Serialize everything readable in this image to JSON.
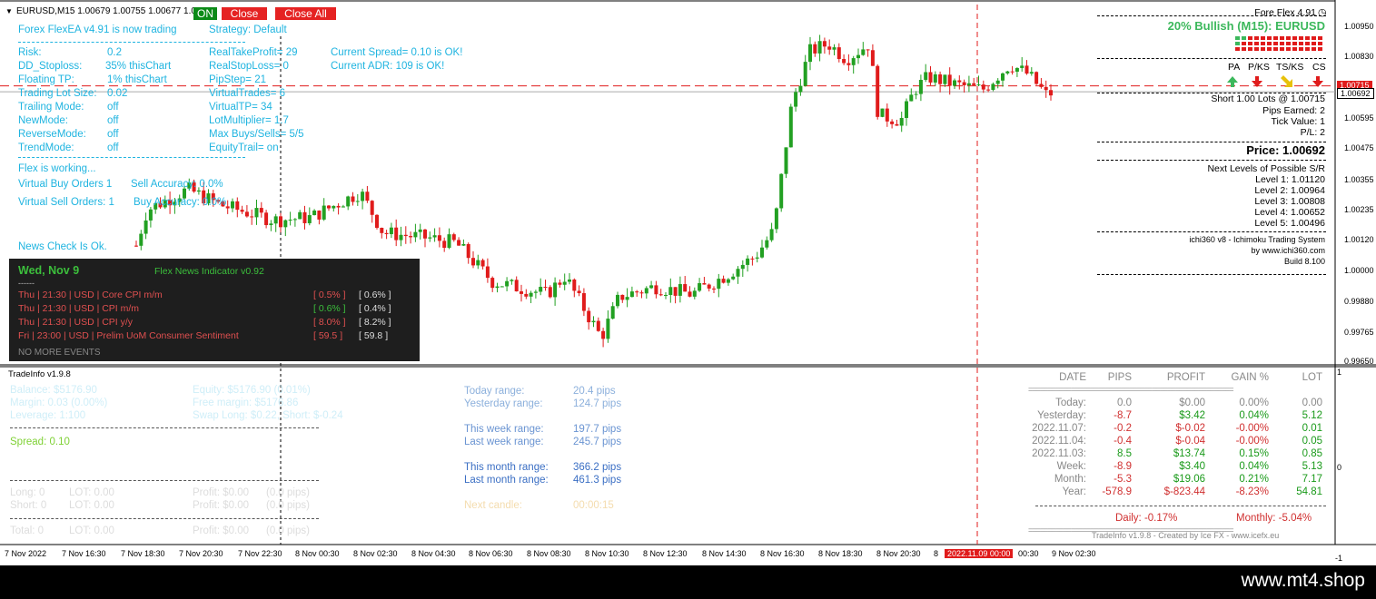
{
  "symbol_header": "EURUSD,M15  1.00679 1.00755 1.00677 1.00",
  "buttons": {
    "on": "ON",
    "close": "Close",
    "close_all": "Close All"
  },
  "flex_panel": {
    "title": "Forex FlexEA v4.91 is now trading",
    "strategy": "Strategy: Default",
    "risk_label": "Risk:",
    "risk_value": "0.2",
    "ddstop_label": "DD_Stoploss:",
    "ddstop_value": "35%  thisChart",
    "float_label": "Floating TP:",
    "float_value": "1%  thisChart",
    "lot_label": "Trading Lot Size:",
    "lot_value": "0.02",
    "trailing_label": "Trailing Mode:",
    "trailing_value": "off",
    "newmode_label": "NewMode:",
    "newmode_value": "off",
    "reverse_label": "ReverseMode:",
    "reverse_value": "off",
    "trend_label": "TrendMode:",
    "trend_value": "off",
    "real_tp": "RealTakeProfit= 29",
    "real_sl": "RealStopLoss= 0",
    "pipstep": "PipStep= 21",
    "virtual_trades": "VirtualTrades= 6",
    "virtual_tp": "VirtualTP= 34",
    "lot_mult": "LotMultiplier= 1.7",
    "max_buys": "Max Buys/Sells= 5/5",
    "equity_trail": "EquityTrail= on",
    "spread": "Current Spread= 0.10 is OK!",
    "adr": "Current ADR: 109  is OK!",
    "working": "Flex is working...",
    "vbuy": "Virtual Buy Orders 1",
    "sell_acc": "Sell Accuracy: 0.0%",
    "vsell": "Virtual Sell Orders: 1",
    "buy_acc": "Buy Accuracy: 0.0%",
    "news_check": "News Check Is Ok."
  },
  "news": {
    "date": "Wed, Nov 9",
    "title": "Flex News Indicator v0.92",
    "sep": "------",
    "rows": [
      {
        "text": "Thu  |  21:30  |  USD  |  Core CPI m/m",
        "val1": "[ 0.5% ]",
        "val2": "[ 0.6% ]",
        "c1": "#e05050"
      },
      {
        "text": "Thu  |  21:30  |  USD  |  CPI m/m",
        "val1": "[ 0.6% ]",
        "val2": "[ 0.4% ]",
        "c1": "#3cbf3c"
      },
      {
        "text": "Thu  |  21:30  |  USD  |  CPI y/y",
        "val1": "[ 8.0% ]",
        "val2": "[ 8.2% ]",
        "c1": "#e05050"
      },
      {
        "text": "Fri  |  23:00  |  USD  |  Prelim UoM Consumer Sentiment",
        "val1": "[ 59.5 ]",
        "val2": "[ 59.8 ]",
        "c1": "#e05050"
      }
    ],
    "footer": "NO MORE EVENTS"
  },
  "right_panel": {
    "version": "Fore Flex 4.91",
    "bullish": "20% Bullish (M15): EURUSD",
    "pa": "PA",
    "pks": "P/KS",
    "tsks": "TS/KS",
    "cs": "CS",
    "short": "Short 1.00 Lots @ 1.00715",
    "pips": "Pips Earned: 2",
    "tick": "Tick Value: 1",
    "pl": "P/L: 2",
    "price": "Price: 1.00692",
    "next": "Next Levels of Possible S/R",
    "levels": [
      "Level 1: 1.01120",
      "Level 2: 1.00964",
      "Level 3: 1.00808",
      "Level 4: 1.00652",
      "Level 5: 1.00496"
    ],
    "ichi1": "ichi360 v8 - Ichimoku Trading System",
    "ichi2": "by www.ichi360.com",
    "ichi3": "Build 8.100"
  },
  "price_axis": [
    "1.00950",
    "1.00830",
    "1.00715",
    "1.00692",
    "1.00595",
    "1.00475",
    "1.00355",
    "1.00235",
    "1.00120",
    "1.00000",
    "0.99880",
    "0.99765",
    "0.99650"
  ],
  "tradeinfo": {
    "title": "TradeInfo v1.9.8",
    "balance": "Balance: $5176.90",
    "equity": "Equity: $5176.90 (0.01%)",
    "margin": "Margin: 0.03 (0.00%)",
    "free_margin": "Free margin: $5176.86",
    "leverage": "Leverage: 1:100",
    "swap": "Swap Long: $0.22, Short: $-0.24",
    "spread": "Spread: 0.10",
    "long": "Long:  0",
    "long_lot": "LOT: 0.00",
    "long_profit": "Profit: $0.00",
    "long_pips": "(0.0 pips)",
    "short": "Short: 0",
    "short_lot": "LOT: 0.00",
    "short_profit": "Profit: $0.00",
    "short_pips": "(0.0 pips)",
    "total": "Total:  0",
    "total_lot": "LOT: 0.00",
    "total_profit": "Profit: $0.00",
    "total_pips": "(0.0 pips)",
    "ranges": [
      {
        "label": "Today range:",
        "value": "20.4 pips"
      },
      {
        "label": "Yesterday range:",
        "value": "124.7 pips"
      },
      {
        "label": "This week range:",
        "value": "197.7 pips"
      },
      {
        "label": "Last week range:",
        "value": "245.7 pips"
      },
      {
        "label": "This month range:",
        "value": "366.2 pips"
      },
      {
        "label": "Last month range:",
        "value": "461.3 pips"
      }
    ],
    "next_candle_label": "Next candle:",
    "next_candle_value": "00:00:15",
    "headers": [
      "DATE",
      "PIPS",
      "PROFIT",
      "GAIN %",
      "LOT"
    ],
    "rows": [
      {
        "date": "Today:",
        "pips": "0.0",
        "profit": "$0.00",
        "gain": "0.00%",
        "lot": "0.00"
      },
      {
        "date": "Yesterday:",
        "pips": "-8.7",
        "profit": "$3.42",
        "gain": "0.04%",
        "lot": "5.12"
      },
      {
        "date": "2022.11.07:",
        "pips": "-0.2",
        "profit": "$-0.02",
        "gain": "-0.00%",
        "lot": "0.01"
      },
      {
        "date": "2022.11.04:",
        "pips": "-0.4",
        "profit": "$-0.04",
        "gain": "-0.00%",
        "lot": "0.05"
      },
      {
        "date": "2022.11.03:",
        "pips": "8.5",
        "profit": "$13.74",
        "gain": "0.15%",
        "lot": "0.85"
      },
      {
        "date": "Week:",
        "pips": "-8.9",
        "profit": "$3.40",
        "gain": "0.04%",
        "lot": "5.13"
      },
      {
        "date": "Month:",
        "pips": "-5.3",
        "profit": "$19.06",
        "gain": "0.21%",
        "lot": "7.17"
      },
      {
        "date": "Year:",
        "pips": "-578.9",
        "profit": "$-823.44",
        "gain": "-8.23%",
        "lot": "54.81"
      }
    ],
    "daily": "Daily: -0.17%",
    "monthly": "Monthly: -5.04%",
    "credit": "TradeInfo v1.9.8 - Created by Ice FX - www.icefx.eu"
  },
  "sub_axis": [
    "1",
    "0",
    "-1"
  ],
  "time_axis": [
    "7 Nov 2022",
    "7 Nov 16:30",
    "7 Nov 18:30",
    "7 Nov 20:30",
    "7 Nov 22:30",
    "8 Nov 00:30",
    "8 Nov 02:30",
    "8 Nov 04:30",
    "8 Nov 06:30",
    "8 Nov 08:30",
    "8 Nov 10:30",
    "8 Nov 12:30",
    "8 Nov 14:30",
    "8 Nov 16:30",
    "8 Nov 18:30",
    "8 Nov 20:30",
    "8",
    "2022.11.09 00:00",
    "00:30",
    "9 Nov 02:30"
  ],
  "watermark": "www.mt4.shop",
  "colors": {
    "bull": "#22a022",
    "bear": "#e01b1b",
    "cyan": "#1fb4e0",
    "ask_line": "#e01b1b"
  }
}
